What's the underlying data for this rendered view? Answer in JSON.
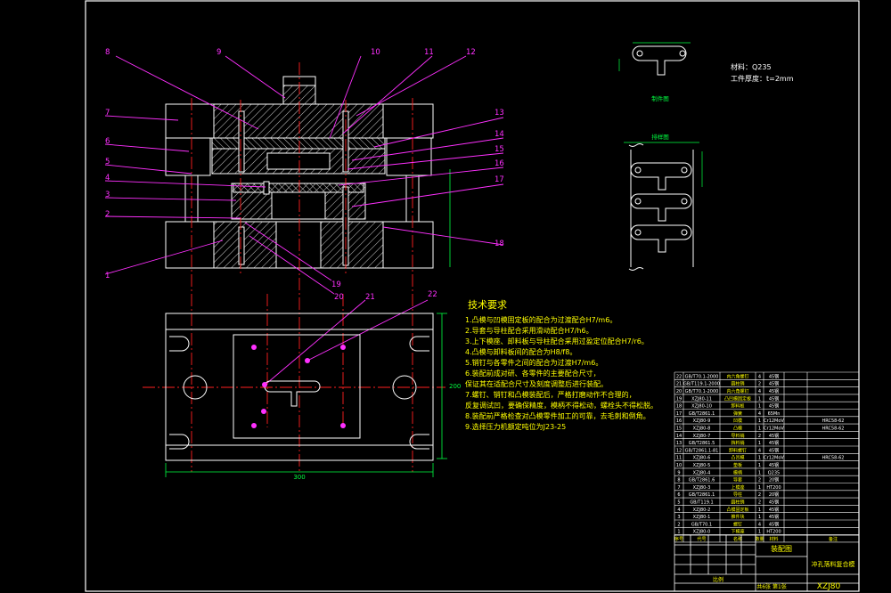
{
  "drawing": {
    "callouts": [
      "1",
      "2",
      "3",
      "4",
      "5",
      "6",
      "7",
      "8",
      "9",
      "10",
      "11",
      "12",
      "13",
      "14",
      "15",
      "16",
      "17",
      "18",
      "19",
      "20",
      "21",
      "22"
    ],
    "material_label": "材料：Q235",
    "thickness_label": "工件厚度：t=2mm",
    "part_caption": "制件图",
    "strip_caption": "排样图",
    "width_dim": "300",
    "height_dim": "200",
    "tech_title": "技术要求",
    "tech_items": [
      "1.凸模与凹模固定板的配合为过渡配合H7/m6。",
      "2.导套与导柱配合采用滑动配合H7/h6。",
      "3.上下模座、卸料板与导柱配合采用过盈定位配合H7/r6。",
      "4.凸模与卸料板间的配合为H8/f8。",
      "5.销钉与各零件之间的配合为过渡H7/m6。",
      "6.装配前成对研、各零件的主要配合尺寸，",
      "  保证其在适配合尺寸及刻度调整后进行装配。",
      "7.螺钉、销钉和凸模装配后，严格打磨动作不合理的，",
      "  反复调试凹，要确保精度，模柄不得松动，螺栓头不得松脱。",
      "8.装配前严格检查对凸模零件加工的可靠，去毛刺和倒角。",
      "9.选择压力机额定吨位为J23-25"
    ]
  },
  "bom": {
    "rows": [
      [
        "22",
        "GB/T70.1-2000",
        "内六角螺钉",
        "4",
        "45钢",
        ""
      ],
      [
        "21",
        "GB/T119.1-2000",
        "圆柱销",
        "2",
        "45钢",
        ""
      ],
      [
        "20",
        "GB/T70.1-2000",
        "内六角螺钉",
        "4",
        "45钢",
        ""
      ],
      [
        "19",
        "XZJ80-11",
        "凸凹模固定板",
        "1",
        "45钢",
        ""
      ],
      [
        "18",
        "XZJ80-10",
        "卸料板",
        "1",
        "45钢",
        ""
      ],
      [
        "17",
        "GB/T2861.1",
        "弹簧",
        "4",
        "65Mn",
        ""
      ],
      [
        "16",
        "XZJ80-9",
        "凹模",
        "1",
        "Cr12MoV",
        "HRC58-62"
      ],
      [
        "15",
        "XZJ80-8",
        "凸模",
        "1",
        "Cr12MoV",
        "HRC58-62"
      ],
      [
        "14",
        "XZJ80-7",
        "导料销",
        "2",
        "45钢",
        ""
      ],
      [
        "13",
        "GB/T2861.5",
        "挡料销",
        "1",
        "45钢",
        ""
      ],
      [
        "12",
        "GB/T2861.1-81",
        "卸料螺钉",
        "4",
        "45钢",
        ""
      ],
      [
        "11",
        "XZJ80-6",
        "凸凹模",
        "1",
        "Cr12MoV",
        "HRC58-62"
      ],
      [
        "10",
        "XZJ80-5",
        "垫板",
        "1",
        "45钢",
        ""
      ],
      [
        "9",
        "XZJ80-4",
        "模柄",
        "1",
        "Q235",
        ""
      ],
      [
        "8",
        "GB/T2861.6",
        "导套",
        "2",
        "20钢",
        ""
      ],
      [
        "7",
        "XZJ80-3",
        "上模座",
        "1",
        "HT200",
        ""
      ],
      [
        "6",
        "GB/T2861.1",
        "导柱",
        "2",
        "20钢",
        ""
      ],
      [
        "5",
        "GB/T119.1",
        "圆柱销",
        "2",
        "45钢",
        ""
      ],
      [
        "4",
        "XZJ80-2",
        "凸模固定板",
        "1",
        "45钢",
        ""
      ],
      [
        "3",
        "XZJ80-1",
        "推件块",
        "1",
        "45钢",
        ""
      ],
      [
        "2",
        "GB/T70.1",
        "螺钉",
        "4",
        "45钢",
        ""
      ],
      [
        "1",
        "XZJ80-0",
        "下模座",
        "1",
        "HT200",
        ""
      ]
    ],
    "header": [
      "序号",
      "代号",
      "名称",
      "数量",
      "材料",
      "备注"
    ],
    "title_block": {
      "drawing_name": "装配图",
      "part_name": "冲孔落料复合模",
      "drawing_no": "XZJ80",
      "sheet": "共6张 第1张",
      "scale": "比例"
    }
  },
  "colors": {
    "background": "#000000",
    "outline": "#ffffff",
    "centerline": "#ff2020",
    "leader": "#ff30ff",
    "hatch": "#ffffff",
    "dimension": "#00ff40",
    "heading": "#ffff00",
    "tech_text": "#ffff00"
  }
}
